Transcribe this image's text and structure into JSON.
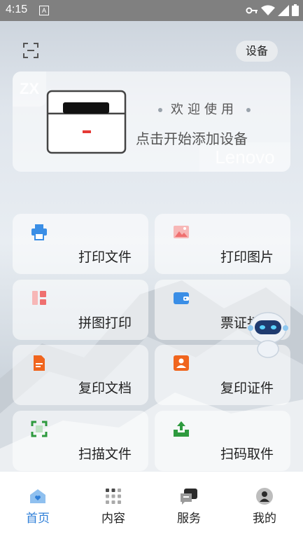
{
  "status_bar": {
    "time": "4:15",
    "notification_letter": "A",
    "icons": [
      "key-icon",
      "wifi-icon",
      "signal-icon",
      "battery-icon"
    ]
  },
  "header": {
    "scan_icon": "scan-icon",
    "device_button": "设备"
  },
  "hero": {
    "watermark_left": "ZX",
    "welcome": "欢迎使用",
    "tap_hint": "点击开始添加设备",
    "watermark_brand": "Lenovo"
  },
  "functions": [
    {
      "label": "打印文件",
      "icon": "printer-icon",
      "color": "#3a8ee6"
    },
    {
      "label": "打印图片",
      "icon": "image-icon",
      "color": "#f08a8a"
    },
    {
      "label": "拼图打印",
      "icon": "collage-icon",
      "color": "#f08a8a"
    },
    {
      "label": "票证打印",
      "icon": "wallet-icon",
      "color": "#3a8ee6"
    },
    {
      "label": "复印文档",
      "icon": "document-icon",
      "color": "#f0651e"
    },
    {
      "label": "复印证件",
      "icon": "id-card-icon",
      "color": "#f0651e"
    },
    {
      "label": "扫描文件",
      "icon": "scan-frame-icon",
      "color": "#2e9a3e"
    },
    {
      "label": "扫码取件",
      "icon": "tray-upload-icon",
      "color": "#2e9a3e"
    }
  ],
  "tabs": [
    {
      "label": "首页",
      "icon": "home-icon",
      "active": true
    },
    {
      "label": "内容",
      "icon": "grid-icon",
      "active": false
    },
    {
      "label": "服务",
      "icon": "chat-icon",
      "active": false
    },
    {
      "label": "我的",
      "icon": "profile-icon",
      "active": false
    }
  ],
  "colors": {
    "accent": "#2f7fd8"
  }
}
